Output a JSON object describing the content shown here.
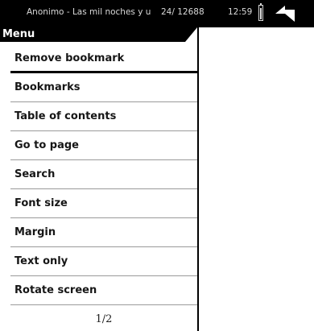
{
  "status_bar": {
    "book_title": "Anonimo - Las mil noches y u",
    "page_indicator": "24/ 12688",
    "clock": "12:59",
    "battery_icon": "battery-icon",
    "rotate_icon": "rotate-left-arrow-icon"
  },
  "menu": {
    "header": "Menu",
    "items": [
      {
        "label": "Remove bookmark",
        "selected": true
      },
      {
        "label": "Bookmarks"
      },
      {
        "label": "Table of contents"
      },
      {
        "label": "Go to page"
      },
      {
        "label": "Search"
      },
      {
        "label": "Font size"
      },
      {
        "label": "Margin"
      },
      {
        "label": "Text only"
      },
      {
        "label": "Rotate screen"
      }
    ],
    "pager": "1/2"
  }
}
